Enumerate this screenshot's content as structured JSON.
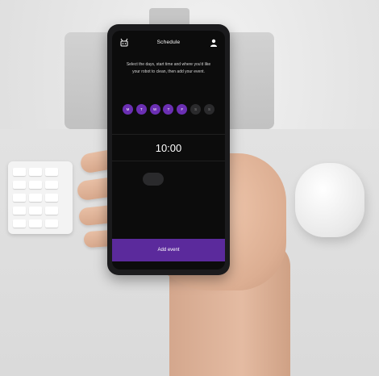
{
  "screen": {
    "title": "Schedule",
    "instructions": "Select the days, start time and where you'd like your robot to clean, then add your event.",
    "days": [
      {
        "label": "M",
        "selected": true
      },
      {
        "label": "T",
        "selected": true
      },
      {
        "label": "W",
        "selected": true
      },
      {
        "label": "T",
        "selected": true
      },
      {
        "label": "F",
        "selected": true
      },
      {
        "label": "S",
        "selected": false
      },
      {
        "label": "S",
        "selected": false
      }
    ],
    "time": "10:00",
    "add_event_label": "Add event",
    "icons": {
      "top_left": "robot-icon",
      "top_right": "user-icon"
    }
  },
  "colors": {
    "accent": "#6b2fb3",
    "button": "#5b2a9c",
    "screen_bg": "#0c0c0c"
  }
}
